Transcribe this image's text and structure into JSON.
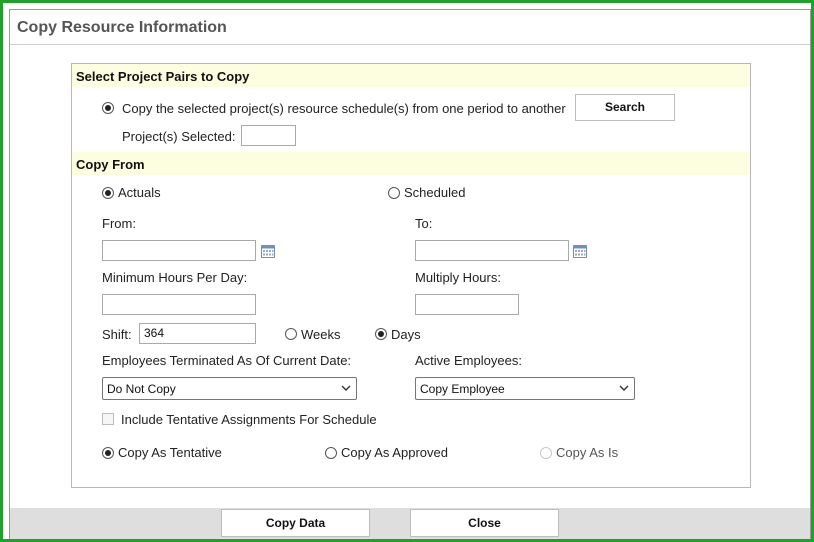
{
  "dialog": {
    "title": "Copy Resource Information"
  },
  "select_section": {
    "header": "Select Project Pairs to Copy",
    "copy_option_label": "Copy the selected project(s) resource schedule(s) from one period to another",
    "search_button": "Search",
    "projects_selected_label": "Project(s) Selected:",
    "projects_selected_value": ""
  },
  "copy_from": {
    "header": "Copy From",
    "actuals_label": "Actuals",
    "scheduled_label": "Scheduled",
    "from_label": "From:",
    "to_label": "To:",
    "from_value": "",
    "to_value": "",
    "min_hours_label": "Minimum Hours Per Day:",
    "min_hours_value": "",
    "multiply_hours_label": "Multiply Hours:",
    "multiply_hours_value": "",
    "shift_label": "Shift:",
    "shift_value": "364",
    "weeks_label": "Weeks",
    "days_label": "Days",
    "terminated_label": "Employees Terminated As Of Current Date:",
    "terminated_selected": "Do Not Copy",
    "active_label": "Active Employees:",
    "active_selected": "Copy Employee",
    "tentative_checkbox_label": "Include Tentative Assignments For Schedule",
    "copy_as_tentative": "Copy As Tentative",
    "copy_as_approved": "Copy As Approved",
    "copy_as_is": "Copy As Is"
  },
  "footer": {
    "copy_data_button": "Copy Data",
    "close_button": "Close"
  },
  "colors": {
    "frame_border": "#1fa22a",
    "section_header_bg": "#fdfde0",
    "footer_bg": "#dedede"
  },
  "icons": {
    "calendar": "calendar-icon",
    "dropdown": "chevron-down-icon"
  }
}
